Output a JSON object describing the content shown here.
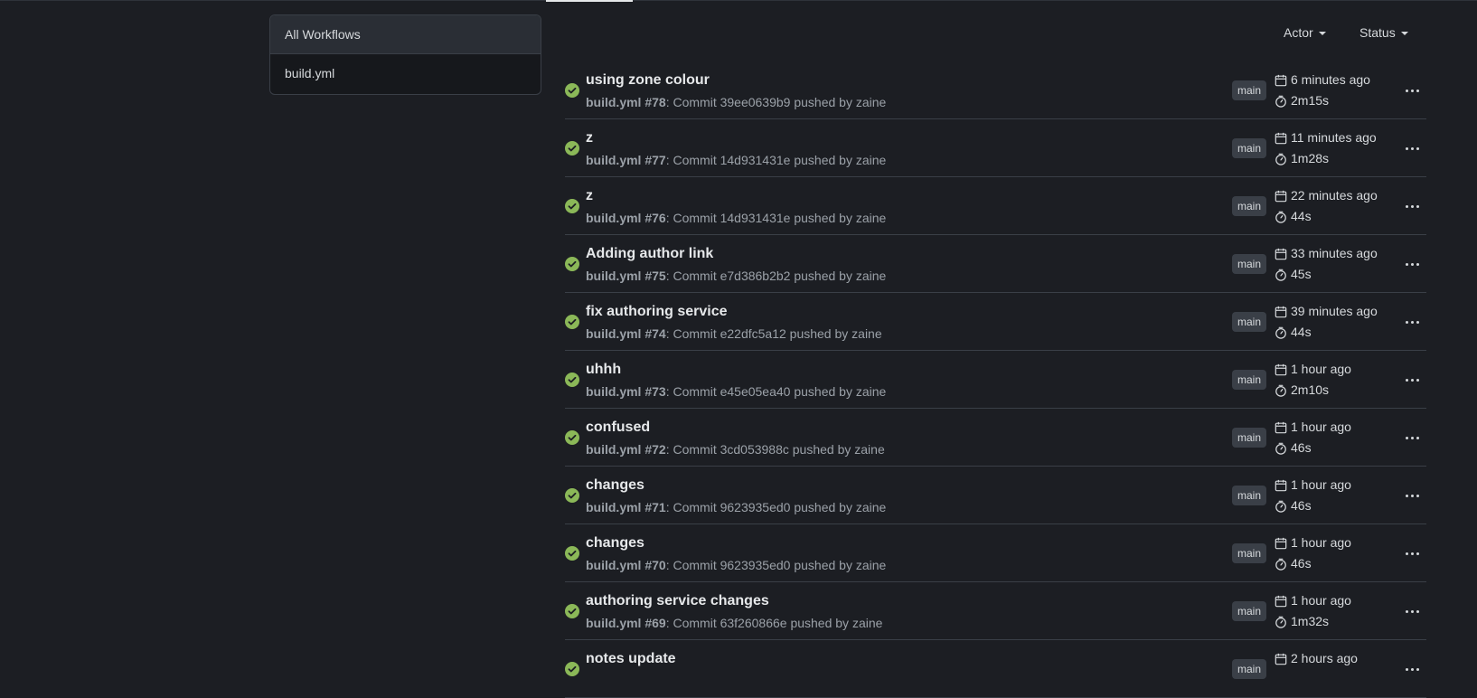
{
  "workflows": {
    "items": [
      {
        "label": "All Workflows",
        "active": true
      },
      {
        "label": "build.yml",
        "active": false
      }
    ]
  },
  "filters": {
    "actor_label": "Actor",
    "status_label": "Status"
  },
  "colors": {
    "success": "#8bb858",
    "background": "#1c1e23",
    "border": "#3a3f47"
  },
  "icons": {
    "status": "check-circle-icon",
    "time": "calendar-icon",
    "duration": "stopwatch-icon",
    "menu": "kebab-horizontal-icon"
  },
  "runs": [
    {
      "title": "using zone colour",
      "workflow": "build.yml #78",
      "details": ": Commit 39ee0639b9 pushed by zaine",
      "branch": "main",
      "time": "6 minutes ago",
      "duration": "2m15s"
    },
    {
      "title": "z",
      "workflow": "build.yml #77",
      "details": ": Commit 14d931431e pushed by zaine",
      "branch": "main",
      "time": "11 minutes ago",
      "duration": "1m28s"
    },
    {
      "title": "z",
      "workflow": "build.yml #76",
      "details": ": Commit 14d931431e pushed by zaine",
      "branch": "main",
      "time": "22 minutes ago",
      "duration": "44s"
    },
    {
      "title": "Adding author link",
      "workflow": "build.yml #75",
      "details": ": Commit e7d386b2b2 pushed by zaine",
      "branch": "main",
      "time": "33 minutes ago",
      "duration": "45s"
    },
    {
      "title": "fix authoring service",
      "workflow": "build.yml #74",
      "details": ": Commit e22dfc5a12 pushed by zaine",
      "branch": "main",
      "time": "39 minutes ago",
      "duration": "44s"
    },
    {
      "title": "uhhh",
      "workflow": "build.yml #73",
      "details": ": Commit e45e05ea40 pushed by zaine",
      "branch": "main",
      "time": "1 hour ago",
      "duration": "2m10s"
    },
    {
      "title": "confused",
      "workflow": "build.yml #72",
      "details": ": Commit 3cd053988c pushed by zaine",
      "branch": "main",
      "time": "1 hour ago",
      "duration": "46s"
    },
    {
      "title": "changes",
      "workflow": "build.yml #71",
      "details": ": Commit 9623935ed0 pushed by zaine",
      "branch": "main",
      "time": "1 hour ago",
      "duration": "46s"
    },
    {
      "title": "changes",
      "workflow": "build.yml #70",
      "details": ": Commit 9623935ed0 pushed by zaine",
      "branch": "main",
      "time": "1 hour ago",
      "duration": "46s"
    },
    {
      "title": "authoring service changes",
      "workflow": "build.yml #69",
      "details": ": Commit 63f260866e pushed by zaine",
      "branch": "main",
      "time": "1 hour ago",
      "duration": "1m32s"
    },
    {
      "title": "notes update",
      "workflow": "",
      "details": "",
      "branch": "main",
      "time": "2 hours ago",
      "duration": ""
    }
  ]
}
